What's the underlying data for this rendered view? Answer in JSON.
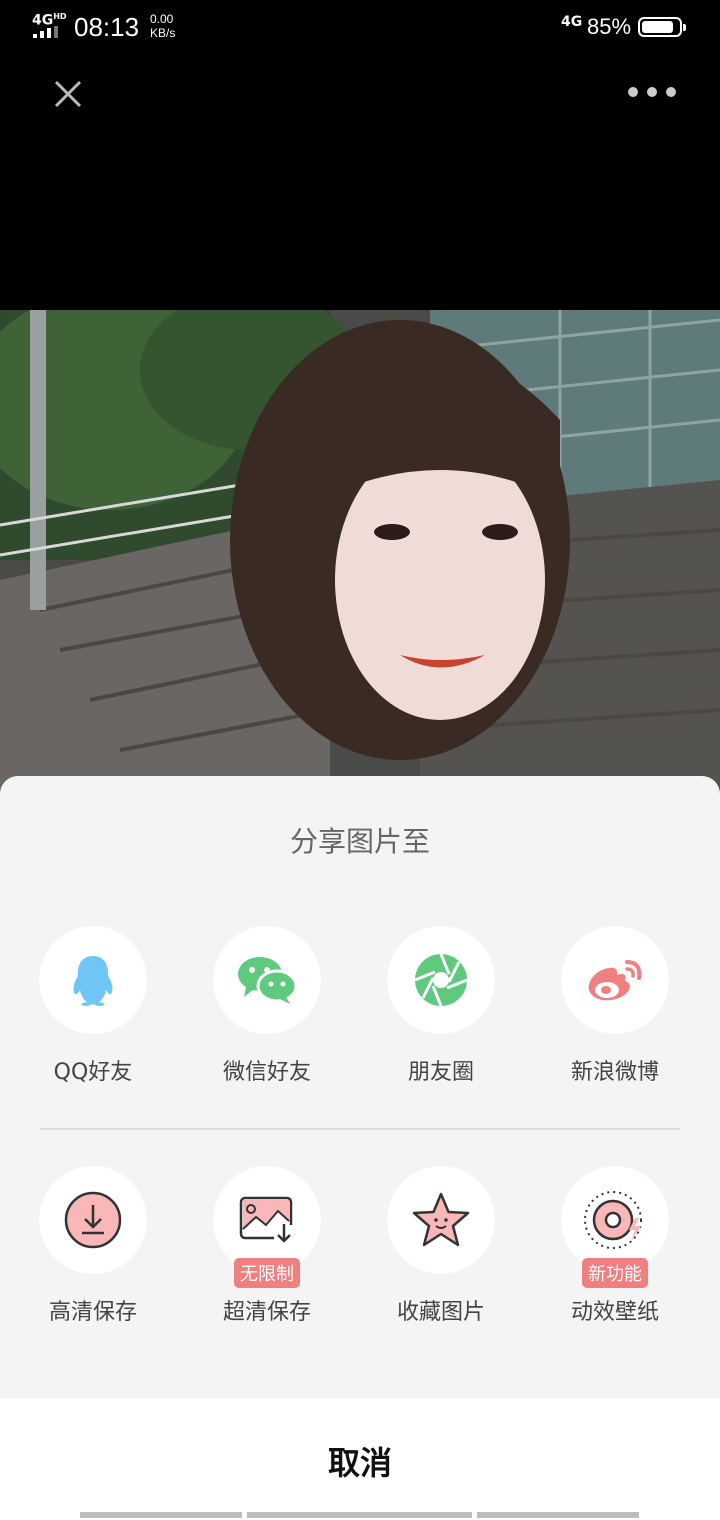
{
  "status_bar": {
    "network_type": "4G",
    "network_hd": "HD",
    "time": "08:13",
    "speed_value": "0.00",
    "speed_unit": "KB/s",
    "mobile_data": "4G",
    "battery_pct": "85%",
    "battery_level": 0.85
  },
  "toolbar": {
    "close_icon": "close-icon",
    "more_icon": "more-dots-icon"
  },
  "share_sheet": {
    "title": "分享图片至",
    "row1": [
      {
        "label": "QQ好友",
        "icon": "qq-icon",
        "color": "#6fc6f4"
      },
      {
        "label": "微信好友",
        "icon": "wechat-icon",
        "color": "#5fc97e"
      },
      {
        "label": "朋友圈",
        "icon": "moments-icon",
        "color": "#5fc97e"
      },
      {
        "label": "新浪微博",
        "icon": "weibo-icon",
        "color": "#f07f80"
      }
    ],
    "row2": [
      {
        "label": "高清保存",
        "icon": "download-icon",
        "badge": ""
      },
      {
        "label": "超清保存",
        "icon": "image-save-icon",
        "badge": "无限制"
      },
      {
        "label": "收藏图片",
        "icon": "star-icon",
        "badge": ""
      },
      {
        "label": "动效壁纸",
        "icon": "live-wallpaper-icon",
        "badge": "新功能"
      }
    ],
    "accent_color": "#f07f80"
  },
  "cancel": {
    "label": "取消"
  }
}
